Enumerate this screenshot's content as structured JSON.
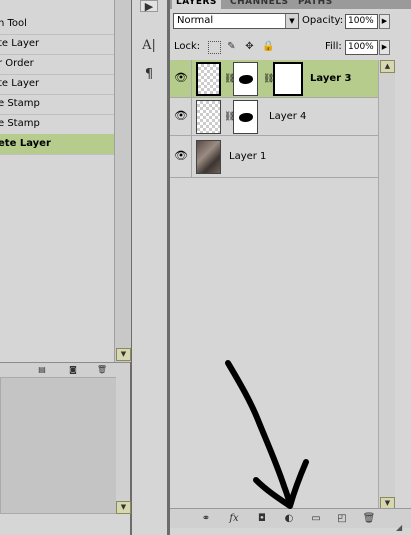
{
  "history": {
    "items": [
      {
        "label": "h Tool",
        "active": false
      },
      {
        "label": "te Layer",
        "active": false
      },
      {
        "label": "r Order",
        "active": false
      },
      {
        "label": "te Layer",
        "active": false
      },
      {
        "label": "e Stamp",
        "active": false
      },
      {
        "label": "e Stamp",
        "active": false
      },
      {
        "label": "ete Layer",
        "active": true
      }
    ],
    "bottom_icons": [
      "new-document-from-state-icon",
      "new-snapshot-icon",
      "delete-state-icon"
    ]
  },
  "toolstrip": {
    "icons": [
      "play-icon",
      "character-icon",
      "paragraph-icon"
    ],
    "character_glyph": "A|",
    "paragraph_glyph": "¶"
  },
  "layers_panel": {
    "tabs": [
      "LAYERS",
      "CHANNELS",
      "PATHS"
    ],
    "active_tab": "LAYERS",
    "blend_mode": "Normal",
    "opacity_label": "Opacity:",
    "opacity_value": "100%",
    "lock_label": "Lock:",
    "fill_label": "Fill:",
    "fill_value": "100%",
    "layers": [
      {
        "name": "Layer 3",
        "selected": true,
        "visible": true
      },
      {
        "name": "Layer 4",
        "selected": false,
        "visible": true
      },
      {
        "name": "Layer 1",
        "selected": false,
        "visible": true
      }
    ],
    "bottom_icons": [
      "link-layers-icon",
      "layer-style-icon",
      "add-mask-icon",
      "adjustment-layer-icon",
      "new-group-icon",
      "new-layer-icon",
      "delete-layer-icon"
    ],
    "fx_label": "fx"
  },
  "colors": {
    "selection": "#b6cc8c",
    "panel": "#d6d6d6",
    "annotation_arrow": "#000000"
  }
}
